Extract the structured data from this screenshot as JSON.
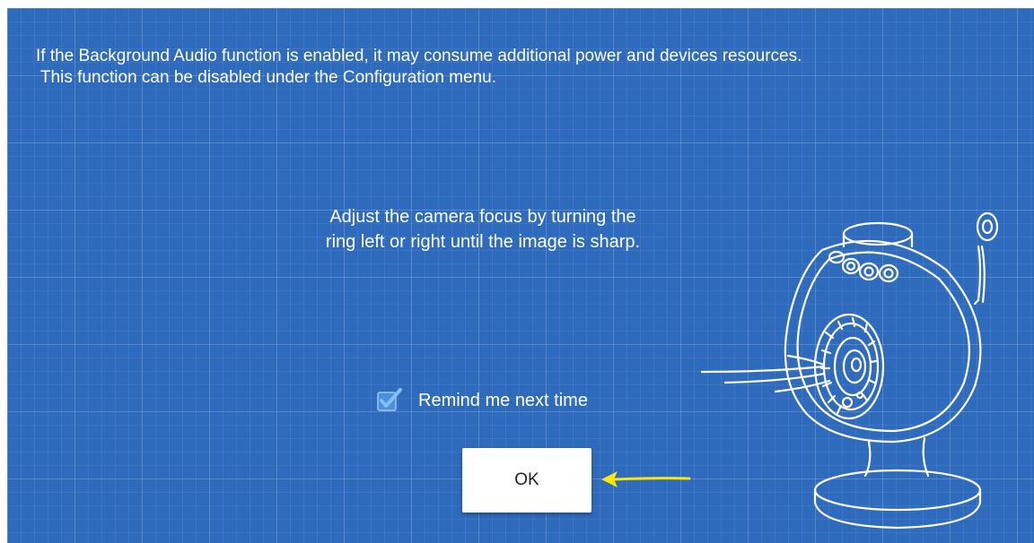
{
  "dialog": {
    "notice_line_1": "If the Background Audio function is enabled, it may consume additional power and devices resources.",
    "notice_line_2": " This function can be disabled under the Configuration menu.",
    "instruction_line_1": "Adjust the camera focus by turning the",
    "instruction_line_2": "ring left or right until the image is sharp.",
    "remind_label": "Remind me next time",
    "remind_checked": true,
    "ok_label": "OK"
  },
  "icons": {
    "camera": "camera-focus-illustration",
    "checkbox": "checkmark-icon",
    "pointer": "yellow-arrow-annotation"
  },
  "colors": {
    "background": "#2f6bbd",
    "checkbox_fill": "#4a90d9",
    "check_mark": "#7fc1ff",
    "arrow": "#ffe600",
    "button": "#ffffff"
  }
}
